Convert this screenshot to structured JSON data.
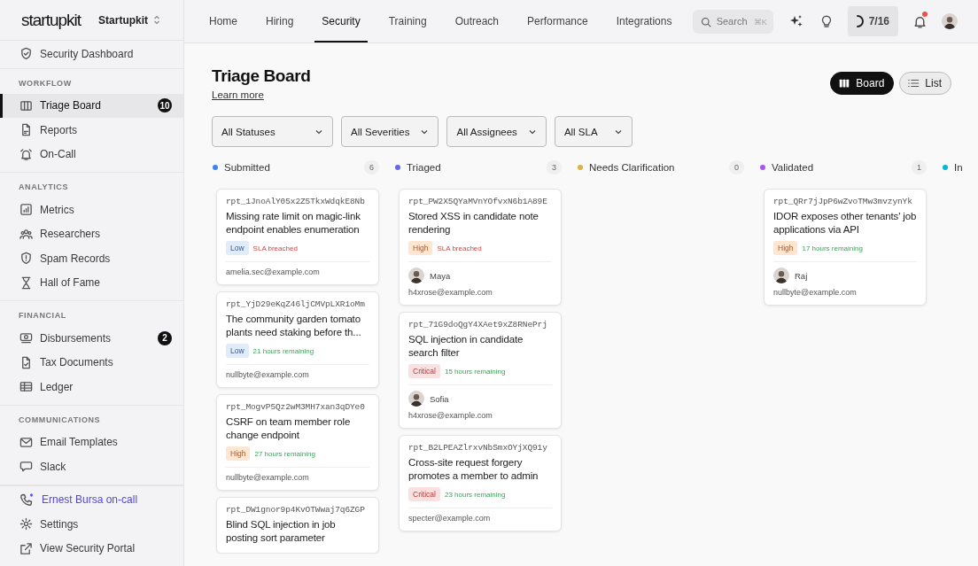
{
  "sidebar": {
    "brand": "startupkit",
    "workspace": "Startupkit",
    "top_items": [
      {
        "label": "Security Dashboard",
        "kind": "shield",
        "selected": false
      }
    ],
    "sections": [
      {
        "title": "WORKFLOW",
        "items": [
          {
            "label": "Triage Board",
            "kind": "columns",
            "selected": true,
            "badge": "10"
          },
          {
            "label": "Reports",
            "kind": "document",
            "selected": false
          },
          {
            "label": "On-Call",
            "kind": "alarm",
            "selected": false
          }
        ]
      },
      {
        "title": "ANALYTICS",
        "items": [
          {
            "label": "Metrics",
            "kind": "chart",
            "selected": false
          },
          {
            "label": "Researchers",
            "kind": "people",
            "selected": false
          },
          {
            "label": "Spam Records",
            "kind": "alert",
            "selected": false
          },
          {
            "label": "Hall of Fame",
            "kind": "hourglass",
            "selected": false
          }
        ]
      },
      {
        "title": "FINANCIAL",
        "items": [
          {
            "label": "Disbursements",
            "kind": "cash",
            "selected": false,
            "badge": "2"
          },
          {
            "label": "Tax Documents",
            "kind": "taxdoc",
            "selected": false
          },
          {
            "label": "Ledger",
            "kind": "table",
            "selected": false
          }
        ]
      },
      {
        "title": "COMMUNICATIONS",
        "items": [
          {
            "label": "Email Templates",
            "kind": "mail",
            "selected": false
          },
          {
            "label": "Slack",
            "kind": "chat",
            "selected": false
          }
        ]
      }
    ],
    "footer_items": [
      {
        "label": "Ernest Bursa on-call",
        "kind": "oncall"
      },
      {
        "label": "Settings",
        "kind": "gear"
      },
      {
        "label": "View Security Portal",
        "kind": "external"
      }
    ]
  },
  "header": {
    "tabs": [
      {
        "label": "Home",
        "selected": false
      },
      {
        "label": "Hiring",
        "selected": false
      },
      {
        "label": "Security",
        "selected": true
      },
      {
        "label": "Training",
        "selected": false
      },
      {
        "label": "Outreach",
        "selected": false
      },
      {
        "label": "Performance",
        "selected": false
      },
      {
        "label": "Integrations",
        "selected": false
      }
    ],
    "search": {
      "placeholder": "Search",
      "shortcut": "⌘K"
    },
    "progress": "7/16",
    "notifications": {
      "unread": true
    }
  },
  "page": {
    "title": "Triage Board",
    "learn_more": "Learn more",
    "views": [
      {
        "label": "Board",
        "kind": "board",
        "selected": true
      },
      {
        "label": "List",
        "kind": "list",
        "selected": false
      }
    ],
    "filters": [
      "All Statuses",
      "All Severities",
      "All Assignees",
      "All SLA"
    ]
  },
  "columns": [
    {
      "title": "Submitted",
      "color": "#3b82f6",
      "count": "6",
      "cards": [
        {
          "id": "rpt_1JnoAlY05x2Z5TkxWdqkE8Nb",
          "title": "Missing rate limit on magic-link endpoint enables enumeration",
          "severity": {
            "label": "Low",
            "kind": "low"
          },
          "sla": {
            "text": "SLA breached",
            "kind": "breached"
          },
          "email": "amelia.sec@example.com"
        },
        {
          "id": "rpt_YjD29eKqZ46ljCMVpLXR1oMm",
          "title": "The community garden tomato plants need staking before th...",
          "severity": {
            "label": "Low",
            "kind": "low"
          },
          "sla": {
            "text": "21 hours remaining",
            "kind": "remaining"
          },
          "email": "nullbyte@example.com"
        },
        {
          "id": "rpt_MogvP5Qz2wM3MH7xan3qDYe0",
          "title": "CSRF on team member role change endpoint",
          "severity": {
            "label": "High",
            "kind": "high"
          },
          "sla": {
            "text": "27 hours remaining",
            "kind": "remaining"
          },
          "email": "nullbyte@example.com"
        },
        {
          "id": "rpt_DW1gnor9p4KvOTWwaj7q6ZGP",
          "title": "Blind SQL injection in job posting sort parameter"
        }
      ]
    },
    {
      "title": "Triaged",
      "color": "#6366f1",
      "count": "3",
      "cards": [
        {
          "id": "rpt_PW2X5QYaMVnYOfvxN6b1A89E",
          "title": "Stored XSS in candidate note rendering",
          "severity": {
            "label": "High",
            "kind": "high"
          },
          "sla": {
            "text": "SLA breached",
            "kind": "breached"
          },
          "assignee": "Maya",
          "email": "h4xrose@example.com"
        },
        {
          "id": "rpt_71G9doQgY4XAet9xZ8RNePrj",
          "title": "SQL injection in candidate search filter",
          "severity": {
            "label": "Critical",
            "kind": "critical"
          },
          "sla": {
            "text": "15 hours remaining",
            "kind": "remaining"
          },
          "assignee": "Sofia",
          "email": "h4xrose@example.com"
        },
        {
          "id": "rpt_B2LPEAZlrxvNbSmxOYjXQ91y",
          "title": "Cross-site request forgery promotes a member to admin",
          "severity": {
            "label": "Critical",
            "kind": "critical"
          },
          "sla": {
            "text": "23 hours remaining",
            "kind": "remaining"
          },
          "email": "specter@example.com"
        }
      ]
    },
    {
      "title": "Needs Clarification",
      "color": "#e0b040",
      "count": "0"
    },
    {
      "title": "Validated",
      "color": "#a855f7",
      "count": "1",
      "cards": [
        {
          "id": "rpt_QRr7jJpP6wZvoTMw3mvzynYk",
          "title": "IDOR exposes other tenants' job applications via API",
          "severity": {
            "label": "High",
            "kind": "high"
          },
          "sla": {
            "text": "17 hours remaining",
            "kind": "remaining"
          },
          "assignee": "Raj",
          "email": "nullbyte@example.com"
        }
      ]
    },
    {
      "title": "In",
      "color": "#06b6d4"
    }
  ]
}
